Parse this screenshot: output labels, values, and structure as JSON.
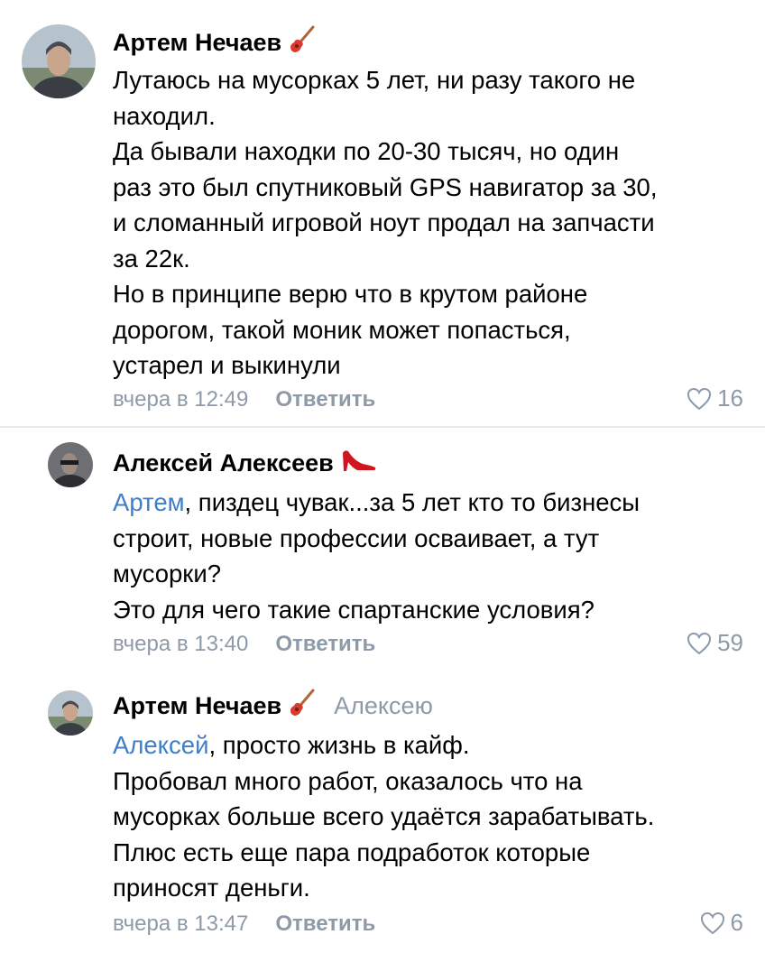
{
  "comments": [
    {
      "author": "Артем Нечаев",
      "badge_icon": "guitar-icon",
      "lines": [
        "Лутаюсь на мусорках 5 лет, ни разу такого не",
        "находил.",
        "Да бывали находки по 20-30 тысяч, но один",
        "раз это был спутниковый GPS навигатор за 30,",
        "и сломанный игровой ноут продал на запчасти",
        "за 22к.",
        "Но в принципе верю что в крутом районе",
        "дорогом, такой моник может попасться,",
        "устарел и выкинули"
      ],
      "time": "вчера в 12:49",
      "reply_label": "Ответить",
      "likes": "16"
    },
    {
      "author": "Алексей Алексеев",
      "badge_icon": "high-heel-icon",
      "mention": "Артем",
      "first_line_rest": ", пиздец чувак...за 5 лет кто то бизнесы",
      "lines": [
        "строит, новые профессии осваивает, а тут",
        "мусорки?",
        "Это для чего такие спартанские условия?"
      ],
      "time": "вчера в 13:40",
      "reply_label": "Ответить",
      "likes": "59"
    },
    {
      "author": "Артем Нечаев",
      "badge_icon": "guitar-icon",
      "reply_to": "Алексею",
      "mention": "Алексей",
      "first_line_rest": ", просто жизнь в кайф.",
      "lines": [
        "Пробовал много работ, оказалось что на",
        "мусорках больше всего удаётся зарабатывать.",
        "Плюс есть еще пара подработок которые",
        "приносят деньги."
      ],
      "time": "вчера в 13:47",
      "reply_label": "Ответить",
      "likes": "6"
    }
  ],
  "colors": {
    "text": "#000000",
    "secondary": "#8e9aa8",
    "mention": "#3f7ec8",
    "divider": "#e6e8eb"
  }
}
